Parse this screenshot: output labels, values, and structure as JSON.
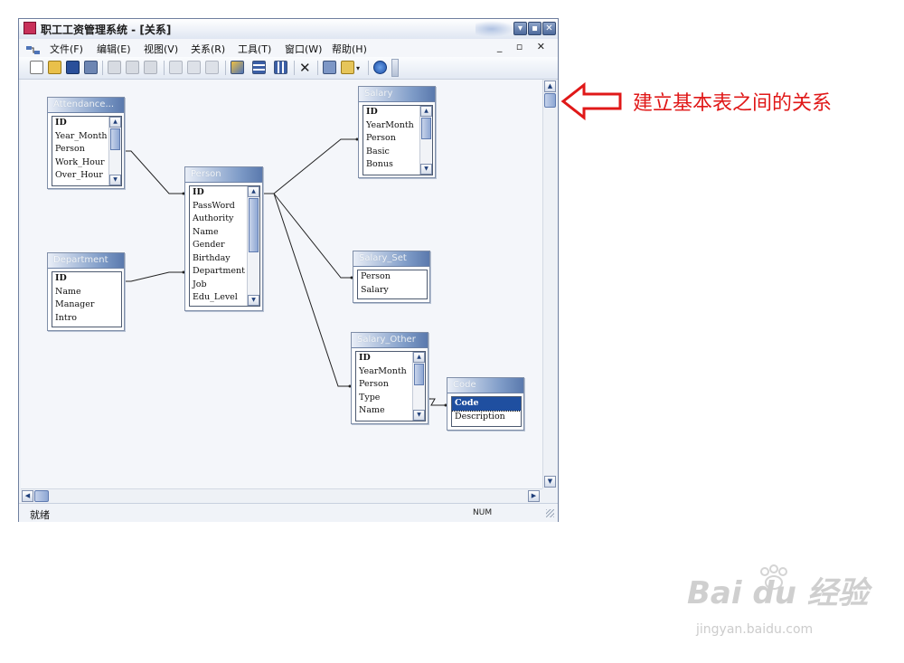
{
  "window": {
    "title": "职工工资管理系统 - [关系]",
    "title_buttons": [
      "▾",
      "▪",
      "✕"
    ],
    "mdi_controls": "_ ▫ ✕"
  },
  "menubar": {
    "items": [
      {
        "label": "文件(F)"
      },
      {
        "label": "编辑(E)"
      },
      {
        "label": "视图(V)"
      },
      {
        "label": "关系(R)"
      },
      {
        "label": "工具(T)"
      },
      {
        "label": "窗口(W)"
      },
      {
        "label": "帮助(H)"
      }
    ]
  },
  "toolbar": {
    "icons": [
      "new-icon",
      "open-icon",
      "save-icon",
      "print-preview-icon",
      "print-icon",
      "preview-icon",
      "spell-check-icon",
      "cut-icon",
      "copy-icon",
      "paste-icon",
      "show-table-icon",
      "direct-relationships-icon",
      "all-relationships-icon",
      "delete-icon",
      "properties-icon",
      "new-object-icon",
      "help-icon"
    ]
  },
  "tables": {
    "attendance": {
      "title": "Attendance...",
      "fields": [
        "ID",
        "Year_Month",
        "Person",
        "Work_Hour",
        "Over_Hour"
      ]
    },
    "department": {
      "title": "Department",
      "fields": [
        "ID",
        "Name",
        "Manager",
        "Intro"
      ]
    },
    "person": {
      "title": "Person",
      "fields": [
        "ID",
        "PassWord",
        "Authority",
        "Name",
        "Gender",
        "Birthday",
        "Department",
        "Job",
        "Edu_Level"
      ]
    },
    "salary": {
      "title": "Salary",
      "fields": [
        "ID",
        "YearMonth",
        "Person",
        "Basic",
        "Bonus"
      ]
    },
    "salary_set": {
      "title": "Salary_Set",
      "fields": [
        "Person",
        "Salary"
      ]
    },
    "salary_other": {
      "title": "Salary_Other",
      "fields": [
        "ID",
        "YearMonth",
        "Person",
        "Type",
        "Name"
      ]
    },
    "code": {
      "title": "Code",
      "fields": [
        "Code",
        "Description"
      ]
    }
  },
  "status": {
    "text": "就绪",
    "num": "NUM"
  },
  "annotation": {
    "text": "建立基本表之间的关系",
    "color": "#e01818"
  },
  "watermark": {
    "text": "Bai du 经验",
    "sub": "jingyan.baidu.com"
  }
}
